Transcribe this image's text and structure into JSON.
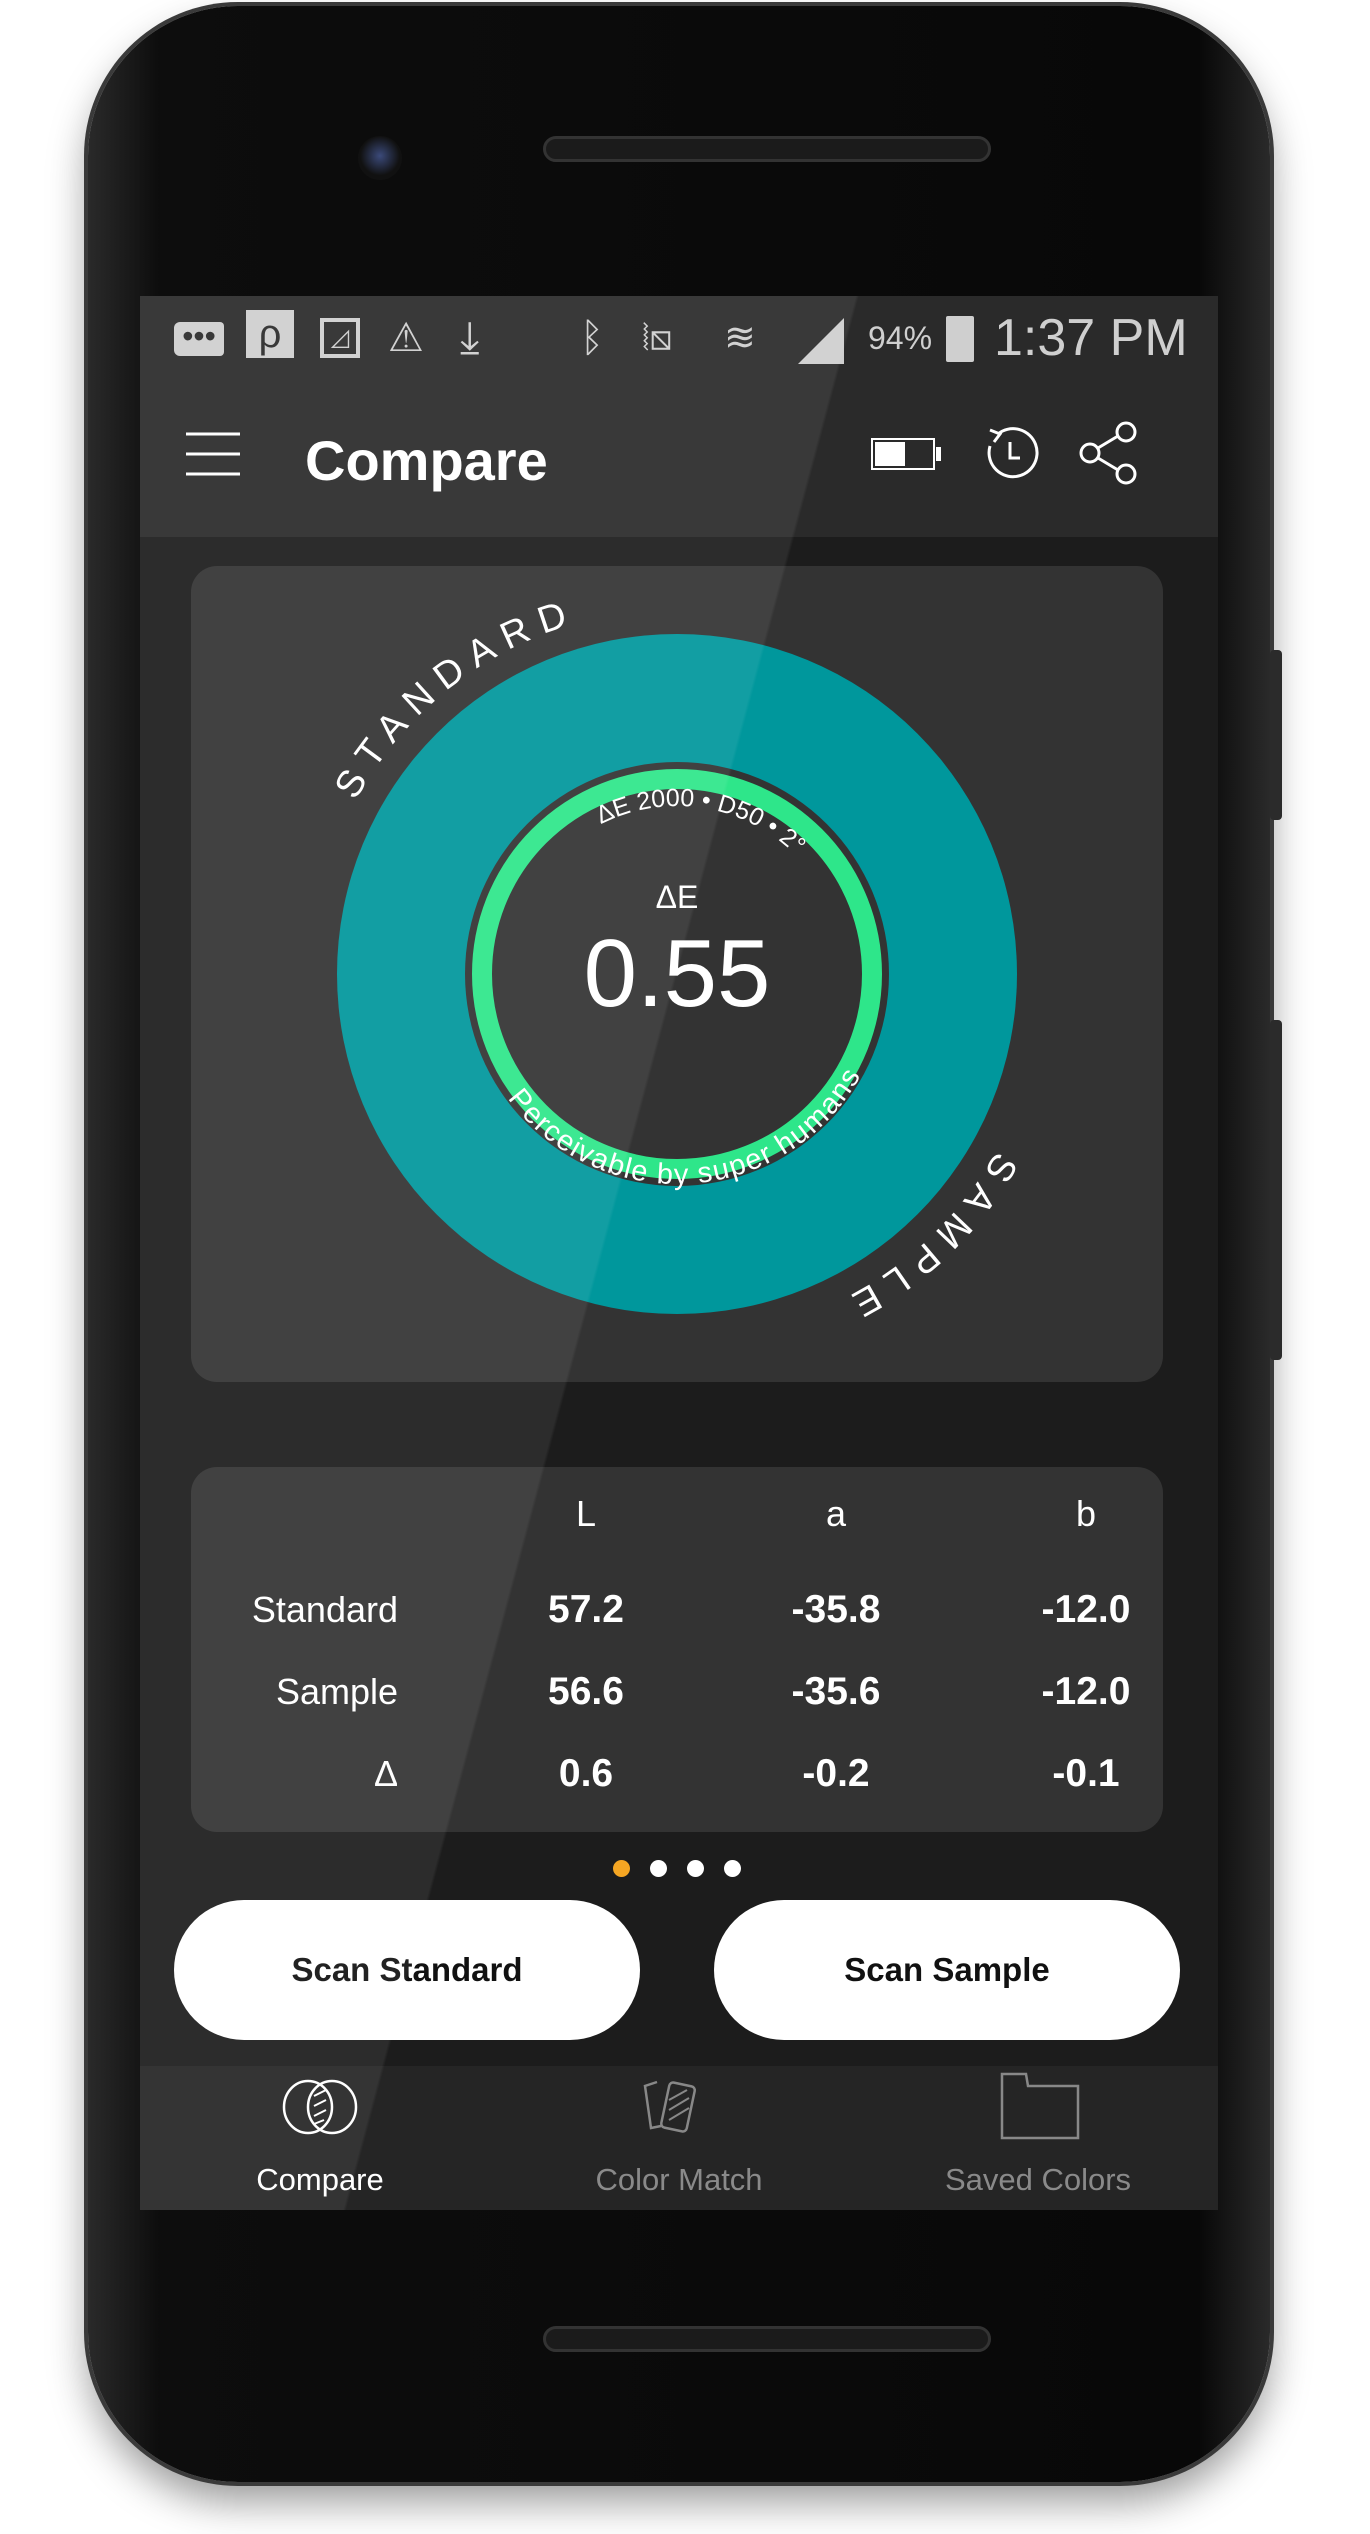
{
  "status_bar": {
    "battery_percent": "94%",
    "time": "1:37 PM",
    "icons": [
      "message-icon",
      "search-app-icon",
      "image-icon",
      "warning-icon",
      "download-icon",
      "bluetooth-icon",
      "vibrate-icon",
      "wifi-icon",
      "signal-icon",
      "battery-icon"
    ]
  },
  "app_bar": {
    "title": "Compare",
    "icons": [
      "menu-icon",
      "device-battery-icon",
      "history-icon",
      "share-icon"
    ]
  },
  "dial": {
    "outer_top_label": "STANDARD",
    "outer_bottom_label": "SAMPLE",
    "method": "ΔE 2000 • D50 • 2°",
    "delta_label": "ΔE",
    "delta_value": "0.55",
    "description": "Perceivable by super humans",
    "standard_color": "#00979c",
    "sample_color": "#00979c",
    "ring_color": "#2ee68a"
  },
  "lab_table": {
    "columns": [
      "L",
      "a",
      "b"
    ],
    "rows": [
      {
        "label": "Standard",
        "values": [
          "57.2",
          "-35.8",
          "-12.0"
        ]
      },
      {
        "label": "Sample",
        "values": [
          "56.6",
          "-35.6",
          "-12.0"
        ]
      },
      {
        "label": "Δ",
        "values": [
          "0.6",
          "-0.2",
          "-0.1"
        ]
      }
    ]
  },
  "pager": {
    "pages": 4,
    "active": 1,
    "active_color": "#f5a623"
  },
  "actions": {
    "scan_standard": "Scan Standard",
    "scan_sample": "Scan Sample"
  },
  "bottom_nav": {
    "items": [
      {
        "label": "Compare",
        "icon": "compare-icon",
        "active": true
      },
      {
        "label": "Color Match",
        "icon": "color-match-icon",
        "active": false
      },
      {
        "label": "Saved Colors",
        "icon": "folder-icon",
        "active": false
      }
    ]
  }
}
